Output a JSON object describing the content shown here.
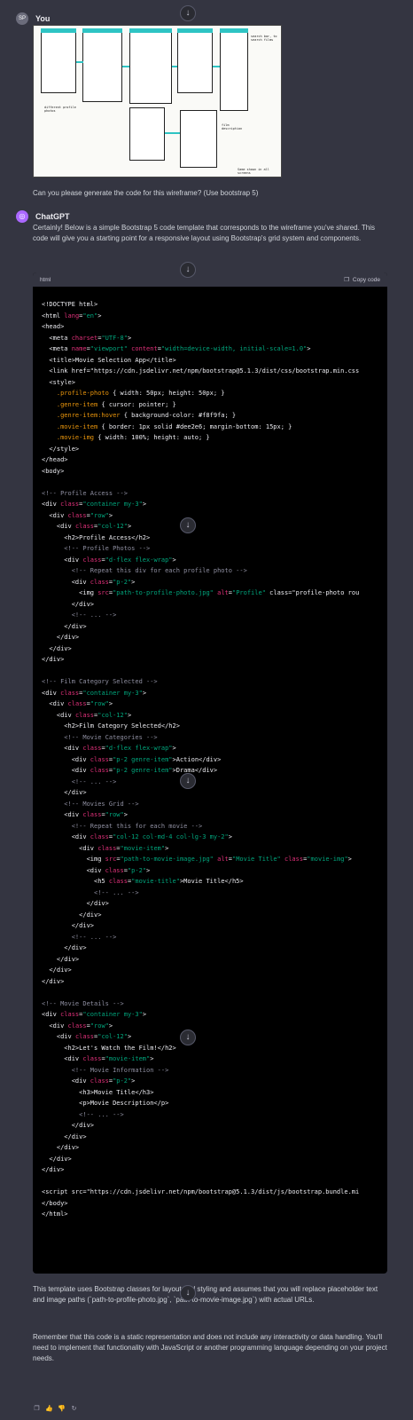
{
  "user": {
    "avatar_text": "SP",
    "name": "You",
    "prompt": "Can you please generate the code for this wireframe? (Use bootstrap 5)"
  },
  "wireframe": {
    "image": "hand-drawn wireframe sketch",
    "labels": [
      "Profile access",
      "Film category selected",
      "Movie details",
      "Let's watch the film!",
      "Film selected"
    ]
  },
  "assistant": {
    "avatar_icon": "openai-logo-icon",
    "name": "ChatGPT",
    "intro": "Certainly! Below is a simple Bootstrap 5 code template that corresponds to the wireframe you've shared. This code will give you a starting point for a responsive layout using Bootstrap's grid system and components.",
    "outro1": "This template uses Bootstrap classes for layout and styling and assumes that you will replace placeholder text and image paths (`path-to-profile-photo.jpg`, `path-to-movie-image.jpg`) with actual URLs.",
    "outro2": "Remember that this code is a static representation and does not include any interactivity or data handling. You'll need to implement that functionality with JavaScript or another programming language depending on your project needs."
  },
  "code_block": {
    "language": "html",
    "copy_label": "Copy code",
    "lines": [
      "<!DOCTYPE html>",
      "<html lang=\"en\">",
      "<head>",
      "  <meta charset=\"UTF-8\">",
      "  <meta name=\"viewport\" content=\"width=device-width, initial-scale=1.0\">",
      "  <title>Movie Selection App</title>",
      "  <link href=\"https://cdn.jsdelivr.net/npm/bootstrap@5.1.3/dist/css/bootstrap.min.css",
      "  <style>",
      "    .profile-photo { width: 50px; height: 50px; }",
      "    .genre-item { cursor: pointer; }",
      "    .genre-item:hover { background-color: #f8f9fa; }",
      "    .movie-item { border: 1px solid #dee2e6; margin-bottom: 15px; }",
      "    .movie-img { width: 100%; height: auto; }",
      "  </style>",
      "</head>",
      "<body>",
      "",
      "<!-- Profile Access -->",
      "<div class=\"container my-3\">",
      "  <div class=\"row\">",
      "    <div class=\"col-12\">",
      "      <h2>Profile Access</h2>",
      "      <!-- Profile Photos -->",
      "      <div class=\"d-flex flex-wrap\">",
      "        <!-- Repeat this div for each profile photo -->",
      "        <div class=\"p-2\">",
      "          <img src=\"path-to-profile-photo.jpg\" alt=\"Profile\" class=\"profile-photo rou",
      "        </div>",
      "        <!-- ... -->",
      "      </div>",
      "    </div>",
      "  </div>",
      "</div>",
      "",
      "<!-- Film Category Selected -->",
      "<div class=\"container my-3\">",
      "  <div class=\"row\">",
      "    <div class=\"col-12\">",
      "      <h2>Film Category Selected</h2>",
      "      <!-- Movie Categories -->",
      "      <div class=\"d-flex flex-wrap\">",
      "        <div class=\"p-2 genre-item\">Action</div>",
      "        <div class=\"p-2 genre-item\">Drama</div>",
      "        <!-- ... -->",
      "      </div>",
      "      <!-- Movies Grid -->",
      "      <div class=\"row\">",
      "        <!-- Repeat this for each movie -->",
      "        <div class=\"col-12 col-md-4 col-lg-3 my-2\">",
      "          <div class=\"movie-item\">",
      "            <img src=\"path-to-movie-image.jpg\" alt=\"Movie Title\" class=\"movie-img\">",
      "            <div class=\"p-2\">",
      "              <h5 class=\"movie-title\">Movie Title</h5>",
      "              <!-- ... -->",
      "            </div>",
      "          </div>",
      "        </div>",
      "        <!-- ... -->",
      "      </div>",
      "    </div>",
      "  </div>",
      "</div>",
      "",
      "<!-- Movie Details -->",
      "<div class=\"container my-3\">",
      "  <div class=\"row\">",
      "    <div class=\"col-12\">",
      "      <h2>Let's Watch the Film!</h2>",
      "      <div class=\"movie-item\">",
      "        <!-- Movie Information -->",
      "        <div class=\"p-2\">",
      "          <h3>Movie Title</h3>",
      "          <p>Movie Description</p>",
      "          <!-- ... -->",
      "        </div>",
      "      </div>",
      "    </div>",
      "  </div>",
      "</div>",
      "",
      "<script src=\"https://cdn.jsdelivr.net/npm/bootstrap@5.1.3/dist/js/bootstrap.bundle.mi",
      "</body>",
      "</html>"
    ]
  },
  "actions": [
    "copy-icon",
    "thumbs-up-icon",
    "thumbs-down-icon",
    "regenerate-icon"
  ],
  "colors": {
    "background": "#343541",
    "code_bg": "#000000",
    "tag": "#ececf1",
    "attr": "#df3079",
    "string": "#00a67d",
    "comment": "#8e8ea0",
    "selector": "#e9950c"
  }
}
